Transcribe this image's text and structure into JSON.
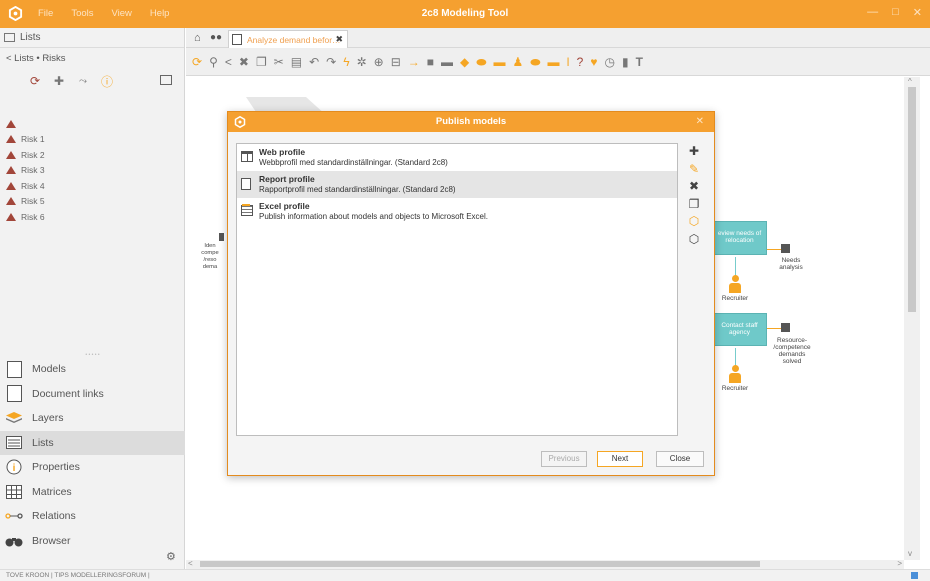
{
  "titlebar": {
    "menu": [
      "File",
      "Tools",
      "View",
      "Help"
    ],
    "app_title": "2c8 Modeling Tool",
    "controls": [
      "—",
      "□",
      "✕"
    ]
  },
  "left_panel": {
    "header": "Lists",
    "breadcrumb": "< Lists • Risks",
    "risk_header": "",
    "risks": [
      "Risk 1",
      "Risk 2",
      "Risk 3",
      "Risk 4",
      "Risk 5",
      "Risk 6"
    ],
    "nav": [
      {
        "label": "Models",
        "icon": "document-icon"
      },
      {
        "label": "Document links",
        "icon": "document-link-icon"
      },
      {
        "label": "Layers",
        "icon": "layers-icon"
      },
      {
        "label": "Lists",
        "icon": "list-icon",
        "active": true
      },
      {
        "label": "Properties",
        "icon": "info-icon"
      },
      {
        "label": "Matrices",
        "icon": "matrix-icon"
      },
      {
        "label": "Relations",
        "icon": "relations-icon"
      },
      {
        "label": "Browser",
        "icon": "binoculars-icon"
      }
    ]
  },
  "tabs": {
    "active_tab": "Analyze demand befor…"
  },
  "canvas": {
    "tasks": [
      {
        "label": "eview needs of relocation"
      },
      {
        "label": "Contact staff agency"
      }
    ],
    "outputs": [
      "Needs analysis",
      "Resource- /competence demands solved"
    ],
    "roles": [
      "Recruiter",
      "Recruiter"
    ],
    "left_label": "Iden compe /reso dema"
  },
  "statusbar": {
    "text": "TOVE KROON | TIPS MODELLERINGSFORUM |"
  },
  "modal": {
    "title": "Publish models",
    "close_glyph": "✕",
    "profiles": [
      {
        "name": "Web profile",
        "description": "Webbprofil med standardinställningar. (Standard 2c8)",
        "icon": "web-profile-icon",
        "selected": false
      },
      {
        "name": "Report profile",
        "description": "Rapportprofil med standardinställningar. (Standard 2c8)",
        "icon": "report-profile-icon",
        "selected": true
      },
      {
        "name": "Excel profile",
        "description": "Publish information about models and objects to Microsoft Excel.",
        "icon": "excel-profile-icon",
        "selected": false
      }
    ],
    "buttons": {
      "previous": "Previous",
      "next": "Next",
      "close": "Close"
    }
  },
  "colors": {
    "accent": "#f5a030",
    "risk": "#a2463a",
    "task": "#6fc9c9"
  }
}
